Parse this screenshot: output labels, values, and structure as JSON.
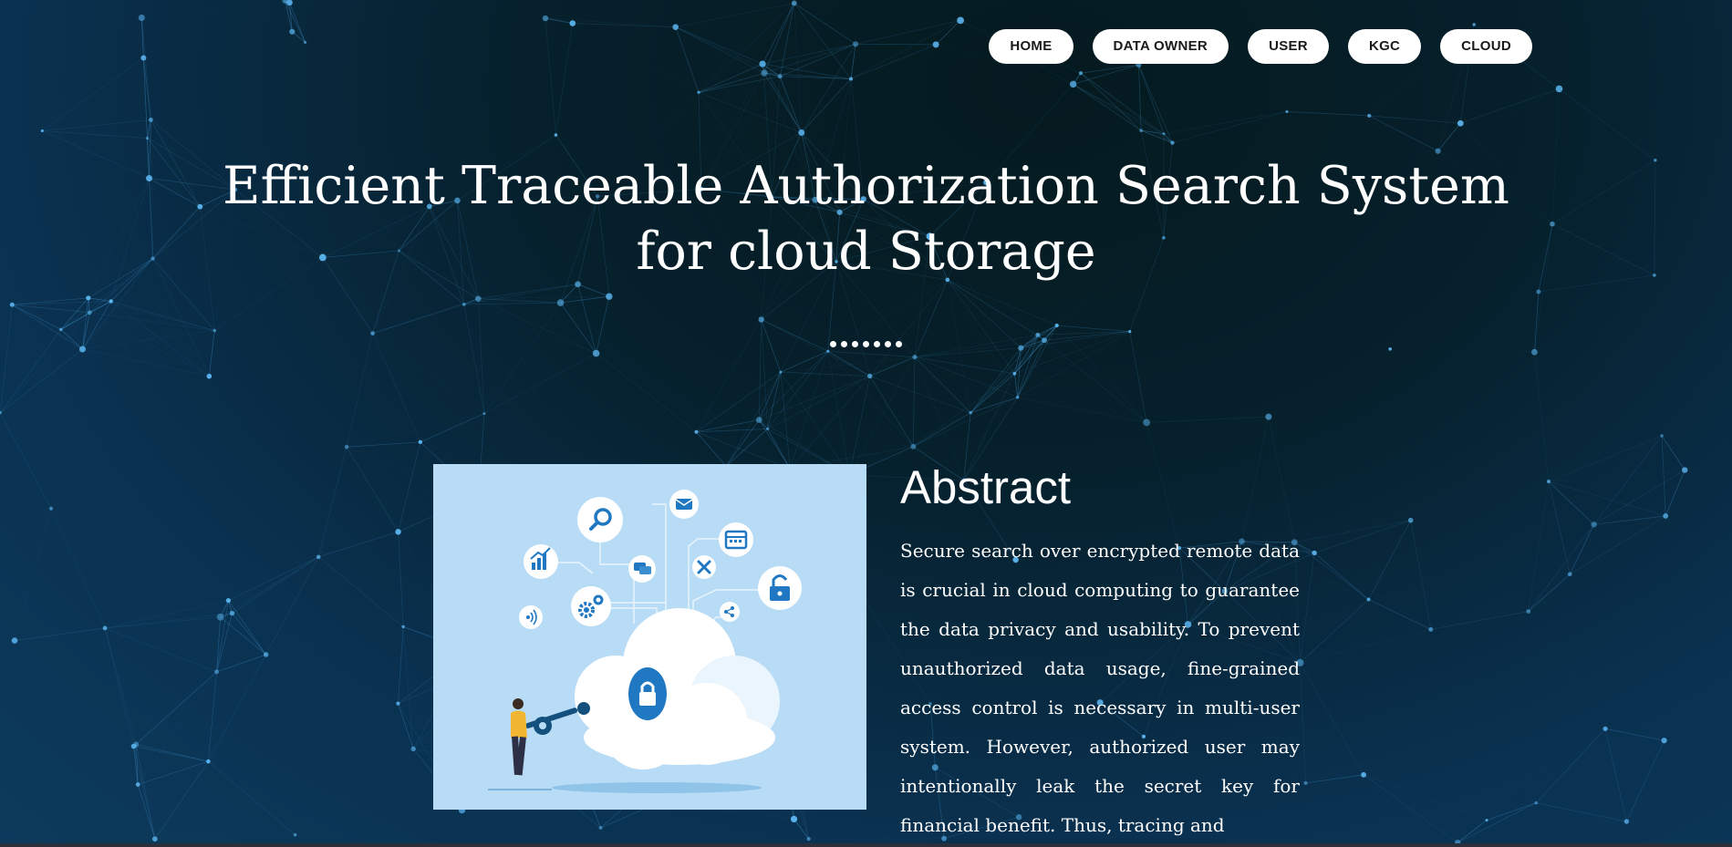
{
  "nav": {
    "items": [
      {
        "label": "HOME"
      },
      {
        "label": "DATA OWNER"
      },
      {
        "label": "USER"
      },
      {
        "label": "KGC"
      },
      {
        "label": "CLOUD"
      }
    ]
  },
  "hero": {
    "title_line1": "Efficient Traceable Authorization Search System",
    "title_line2": "for cloud Storage"
  },
  "abstract": {
    "heading": "Abstract",
    "text": "Secure search over encrypted remote data is crucial in cloud computing to guarantee the data privacy and usability. To prevent unauthorized data usage, fine-grained access control is necessary in multi-user system. However, authorized user may intentionally leak the secret key for financial benefit. Thus, tracing and"
  },
  "colors": {
    "background": "#0a3150",
    "network": "#4aa3e0",
    "illustration_bg": "#b8dcf5",
    "accent_blue": "#1f78c1",
    "figure_yellow": "#f2b632"
  },
  "icons": [
    "search-icon",
    "mail-icon",
    "calendar-icon",
    "bar-chart-icon",
    "chat-icon",
    "tools-icon",
    "lock-icon",
    "gear-icon",
    "share-icon",
    "wifi-icon",
    "cloud-lock-icon",
    "key-icon"
  ]
}
